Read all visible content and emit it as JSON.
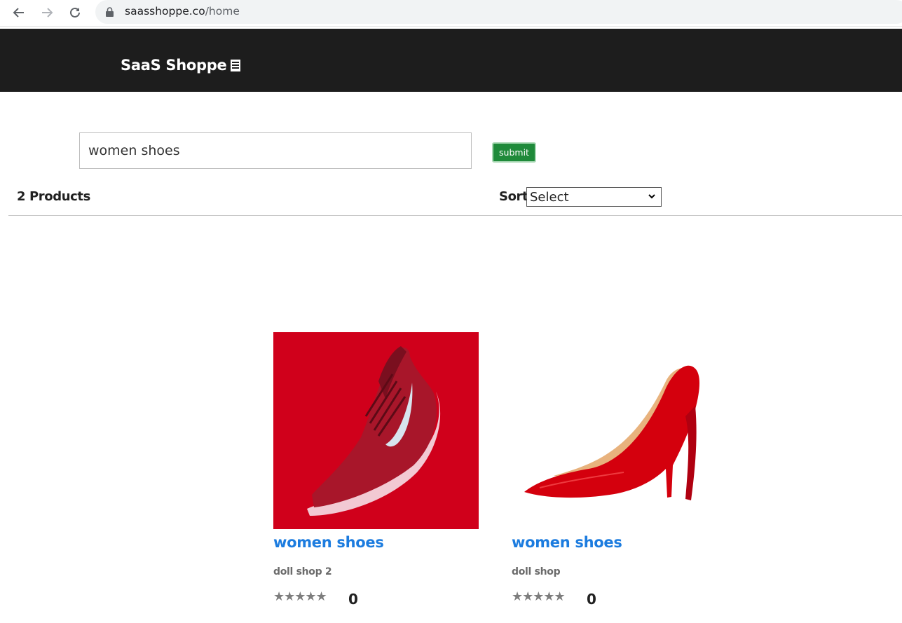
{
  "browser": {
    "url_host": "saasshoppe.co",
    "url_path": "/home"
  },
  "header": {
    "brand": "SaaS Shoppe"
  },
  "search": {
    "value": "women shoes",
    "submit_label": "submit"
  },
  "results": {
    "count_label": "2 Products",
    "sort_label": "Sort",
    "sort_selected": "Select"
  },
  "products": [
    {
      "title": "women shoes",
      "shop": "doll shop 2",
      "stars": "★★★★★",
      "rating": "0",
      "image": "red-sneaker-image"
    },
    {
      "title": "women shoes",
      "shop": "doll shop",
      "stars": "★★★★★",
      "rating": "0",
      "image": "red-high-heel-image"
    }
  ],
  "colors": {
    "header_bg": "#1d1d1d",
    "submit_bg": "#1f8a3a",
    "link": "#1c7cdf"
  }
}
